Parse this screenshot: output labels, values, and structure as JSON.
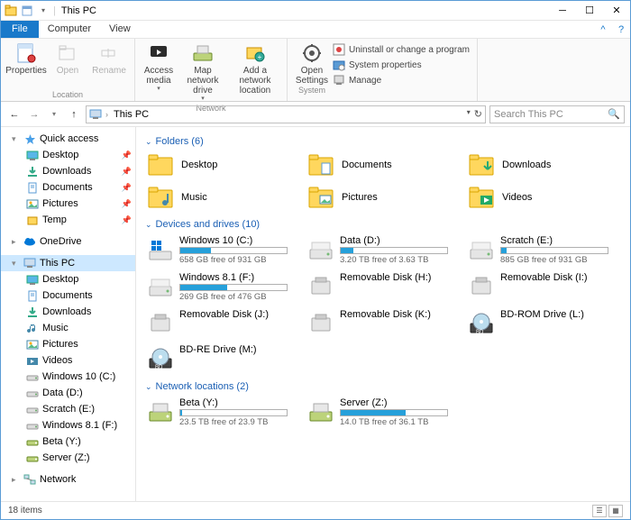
{
  "window": {
    "title": "This PC"
  },
  "menu": {
    "file": "File",
    "computer": "Computer",
    "view": "View"
  },
  "ribbon": {
    "location": {
      "label": "Location",
      "properties": "Properties",
      "open": "Open",
      "rename": "Rename"
    },
    "network": {
      "label": "Network",
      "access_media": "Access media",
      "map_drive": "Map network drive",
      "add_location": "Add a network location"
    },
    "system": {
      "label": "System",
      "open_settings": "Open Settings",
      "uninstall": "Uninstall or change a program",
      "properties": "System properties",
      "manage": "Manage"
    }
  },
  "address": {
    "crumb": "This PC"
  },
  "search": {
    "placeholder": "Search This PC"
  },
  "nav": {
    "quick_access": "Quick access",
    "qa_items": [
      "Desktop",
      "Downloads",
      "Documents",
      "Pictures",
      "Temp"
    ],
    "onedrive": "OneDrive",
    "this_pc": "This PC",
    "pc_items": [
      "Desktop",
      "Documents",
      "Downloads",
      "Music",
      "Pictures",
      "Videos",
      "Windows 10 (C:)",
      "Data (D:)",
      "Scratch (E:)",
      "Windows 8.1 (F:)",
      "Beta (Y:)",
      "Server (Z:)"
    ],
    "network": "Network"
  },
  "sections": {
    "folders": {
      "title": "Folders (6)",
      "items": [
        "Desktop",
        "Documents",
        "Downloads",
        "Music",
        "Pictures",
        "Videos"
      ]
    },
    "drives": {
      "title": "Devices and drives (10)",
      "items": [
        {
          "name": "Windows 10 (C:)",
          "sub": "658 GB free of 931 GB",
          "pct": 29,
          "kind": "os"
        },
        {
          "name": "Data (D:)",
          "sub": "3.20 TB free of 3.63 TB",
          "pct": 12,
          "kind": "hdd"
        },
        {
          "name": "Scratch (E:)",
          "sub": "885 GB free of 931 GB",
          "pct": 5,
          "kind": "hdd"
        },
        {
          "name": "Windows 8.1 (F:)",
          "sub": "269 GB free of 476 GB",
          "pct": 44,
          "kind": "hdd"
        },
        {
          "name": "Removable Disk (H:)",
          "sub": "",
          "pct": null,
          "kind": "removable"
        },
        {
          "name": "Removable Disk (I:)",
          "sub": "",
          "pct": null,
          "kind": "removable"
        },
        {
          "name": "Removable Disk (J:)",
          "sub": "",
          "pct": null,
          "kind": "removable"
        },
        {
          "name": "Removable Disk (K:)",
          "sub": "",
          "pct": null,
          "kind": "removable"
        },
        {
          "name": "BD-ROM Drive (L:)",
          "sub": "",
          "pct": null,
          "kind": "bd"
        },
        {
          "name": "BD-RE Drive (M:)",
          "sub": "",
          "pct": null,
          "kind": "bd"
        }
      ]
    },
    "netloc": {
      "title": "Network locations (2)",
      "items": [
        {
          "name": "Beta (Y:)",
          "sub": "23.5 TB free of 23.9 TB",
          "pct": 2
        },
        {
          "name": "Server (Z:)",
          "sub": "14.0 TB free of 36.1 TB",
          "pct": 61
        }
      ]
    }
  },
  "status": {
    "text": "18 items"
  }
}
